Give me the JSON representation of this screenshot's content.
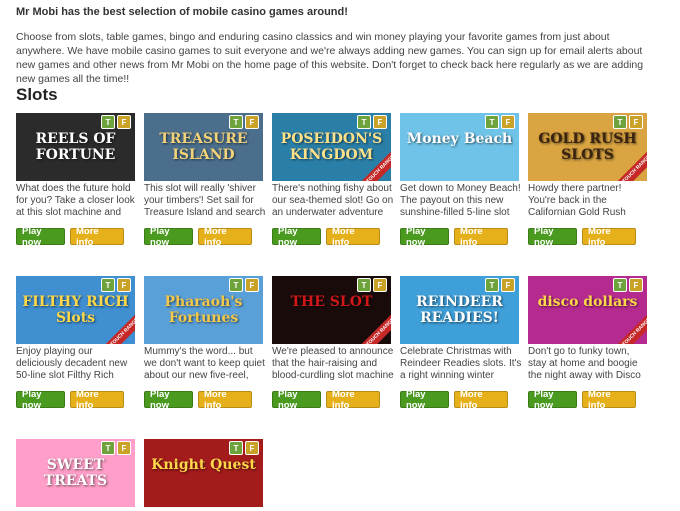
{
  "intro": {
    "title": "Mr Mobi has the best selection of mobile casino games around!",
    "text": "Choose from slots, table games, bingo and enduring casino classics and win money playing your favorite games from just about anywhere. We have mobile casino games to suit everyone and we're always adding new games. You can sign up for email alerts about new games and other news from Mr Mobi on the home page of this website. Don't forget to check back here regularly as we are adding new games all the time!!"
  },
  "section_title": "Slots",
  "buttons": {
    "play": "Play now",
    "info": "More info"
  },
  "badges": {
    "t": "T",
    "f": "F"
  },
  "ribbon_text": "TOUCH RANGE",
  "games": [
    {
      "title": "REELS OF FORTUNE",
      "desc": "What does the future hold for you? Take a closer look at this slot machine and",
      "bg": "#2b2b2b",
      "fg": "#ffffff"
    },
    {
      "title": "TREASURE ISLAND",
      "desc": "This slot will really 'shiver your timbers'! Set sail for Treasure Island and search",
      "bg": "#4a6e8c",
      "fg": "#f2d27a"
    },
    {
      "title": "POSEIDON'S KINGDOM",
      "desc": "There's nothing fishy about our sea-themed slot! Go on an underwater adventure",
      "bg": "#2a7fa8",
      "fg": "#ffe28a"
    },
    {
      "title": "Money Beach",
      "desc": "Get down to Money Beach! The payout on this new sunshine-filled 5-line slot",
      "bg": "#6fc3e8",
      "fg": "#ffffff"
    },
    {
      "title": "GOLD RUSH SLOTS",
      "desc": "Howdy there partner! You're back in the Californian Gold Rush",
      "bg": "#d9a441",
      "fg": "#3a2410"
    },
    {
      "title": "FILTHY RICH Slots",
      "desc": "Enjoy playing our deliciously decadent new 50-line slot Filthy Rich",
      "bg": "#3f8fd1",
      "fg": "#ffd84a"
    },
    {
      "title": "Pharaoh's Fortunes",
      "desc": "Mummy's the word... but we don't want to keep quiet about our new five-reel,",
      "bg": "#5aa0d8",
      "fg": "#f5c84a"
    },
    {
      "title": "THE SLOT",
      "desc": "We're pleased to announce that the hair-raising and blood-curdling slot machine",
      "bg": "#1a0b0b",
      "fg": "#d01818"
    },
    {
      "title": "REINDEER READIES!",
      "desc": "Celebrate Christmas with Reindeer Readies slots. It's a right winning winter",
      "bg": "#3f9fd8",
      "fg": "#ffffff"
    },
    {
      "title": "disco dollars",
      "desc": "Don't go to funky town, stay at home and boogie the night away with Disco",
      "bg": "#b52a8f",
      "fg": "#ffd84a"
    },
    {
      "title": "SWEET TREATS",
      "desc": "",
      "bg": "#ff9ec8",
      "fg": "#ffffff"
    },
    {
      "title": "Knight Quest",
      "desc": "",
      "bg": "#a31b1b",
      "fg": "#ffd84a"
    }
  ]
}
